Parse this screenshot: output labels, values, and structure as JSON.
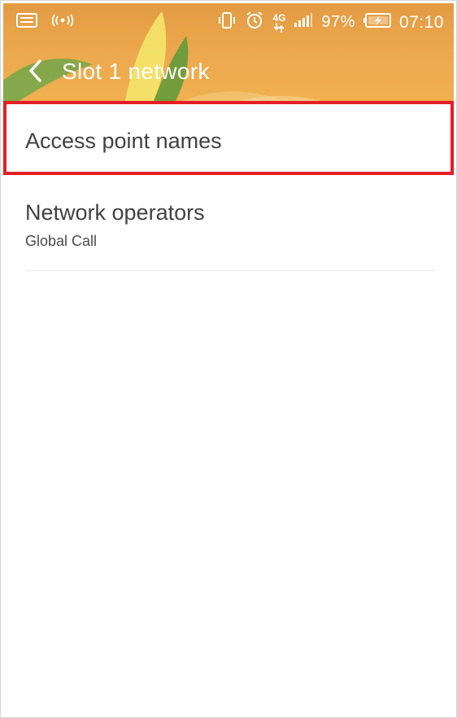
{
  "status_bar": {
    "icons": [
      "keyboard-icon",
      "hotspot-icon",
      "vibrate-icon",
      "alarm-icon",
      "network-4g-icon",
      "signal-icon",
      "battery-charging-icon"
    ],
    "network_type": "4G",
    "battery_percent": "97%",
    "time": "07:10"
  },
  "app_bar": {
    "back_icon": "chevron-left-icon",
    "title": "Slot 1 network"
  },
  "list": {
    "items": [
      {
        "label": "Access point names"
      },
      {
        "label": "Network operators",
        "summary": "Global Call"
      }
    ]
  },
  "colors": {
    "header": "#eda94d",
    "highlight": "#e51e25",
    "text_primary": "#424242"
  }
}
